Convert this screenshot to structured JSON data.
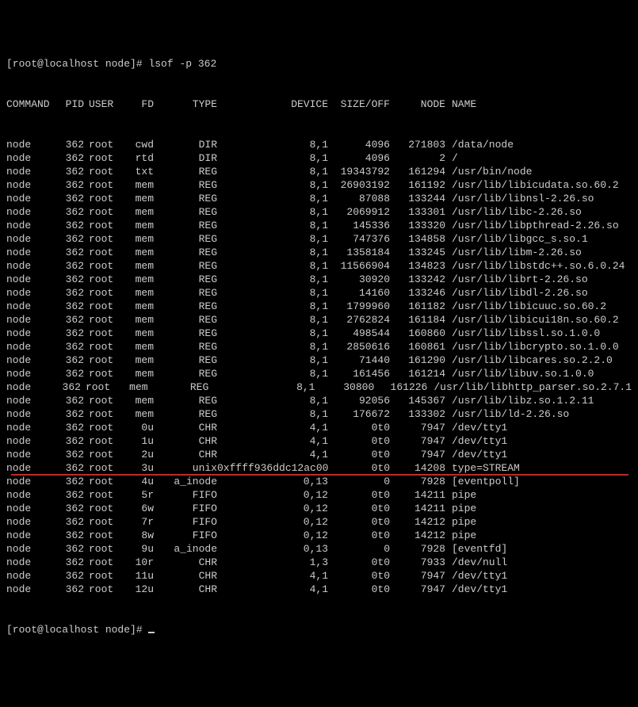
{
  "prompt1": {
    "prefix": "[root@localhost node]# ",
    "cmd": "lsof -p 362"
  },
  "prompt2": {
    "prefix": "[root@localhost node]# "
  },
  "header": {
    "cmd": "COMMAND",
    "pid": "PID",
    "user": "USER",
    "fd": "FD",
    "type": "TYPE",
    "dev": "DEVICE",
    "size": "SIZE/OFF",
    "node": "NODE",
    "name": "NAME"
  },
  "rows": [
    {
      "cmd": "node",
      "pid": "362",
      "user": "root",
      "fd": "cwd",
      "type": "DIR",
      "dev": "8,1",
      "size": "4096",
      "node": "271803",
      "name": "/data/node"
    },
    {
      "cmd": "node",
      "pid": "362",
      "user": "root",
      "fd": "rtd",
      "type": "DIR",
      "dev": "8,1",
      "size": "4096",
      "node": "2",
      "name": "/"
    },
    {
      "cmd": "node",
      "pid": "362",
      "user": "root",
      "fd": "txt",
      "type": "REG",
      "dev": "8,1",
      "size": "19343792",
      "node": "161294",
      "name": "/usr/bin/node"
    },
    {
      "cmd": "node",
      "pid": "362",
      "user": "root",
      "fd": "mem",
      "type": "REG",
      "dev": "8,1",
      "size": "26903192",
      "node": "161192",
      "name": "/usr/lib/libicudata.so.60.2"
    },
    {
      "cmd": "node",
      "pid": "362",
      "user": "root",
      "fd": "mem",
      "type": "REG",
      "dev": "8,1",
      "size": "87088",
      "node": "133244",
      "name": "/usr/lib/libnsl-2.26.so"
    },
    {
      "cmd": "node",
      "pid": "362",
      "user": "root",
      "fd": "mem",
      "type": "REG",
      "dev": "8,1",
      "size": "2069912",
      "node": "133301",
      "name": "/usr/lib/libc-2.26.so"
    },
    {
      "cmd": "node",
      "pid": "362",
      "user": "root",
      "fd": "mem",
      "type": "REG",
      "dev": "8,1",
      "size": "145336",
      "node": "133320",
      "name": "/usr/lib/libpthread-2.26.so"
    },
    {
      "cmd": "node",
      "pid": "362",
      "user": "root",
      "fd": "mem",
      "type": "REG",
      "dev": "8,1",
      "size": "747376",
      "node": "134858",
      "name": "/usr/lib/libgcc_s.so.1"
    },
    {
      "cmd": "node",
      "pid": "362",
      "user": "root",
      "fd": "mem",
      "type": "REG",
      "dev": "8,1",
      "size": "1358184",
      "node": "133245",
      "name": "/usr/lib/libm-2.26.so"
    },
    {
      "cmd": "node",
      "pid": "362",
      "user": "root",
      "fd": "mem",
      "type": "REG",
      "dev": "8,1",
      "size": "11566904",
      "node": "134823",
      "name": "/usr/lib/libstdc++.so.6.0.24"
    },
    {
      "cmd": "node",
      "pid": "362",
      "user": "root",
      "fd": "mem",
      "type": "REG",
      "dev": "8,1",
      "size": "30920",
      "node": "133242",
      "name": "/usr/lib/librt-2.26.so"
    },
    {
      "cmd": "node",
      "pid": "362",
      "user": "root",
      "fd": "mem",
      "type": "REG",
      "dev": "8,1",
      "size": "14160",
      "node": "133246",
      "name": "/usr/lib/libdl-2.26.so"
    },
    {
      "cmd": "node",
      "pid": "362",
      "user": "root",
      "fd": "mem",
      "type": "REG",
      "dev": "8,1",
      "size": "1799960",
      "node": "161182",
      "name": "/usr/lib/libicuuc.so.60.2"
    },
    {
      "cmd": "node",
      "pid": "362",
      "user": "root",
      "fd": "mem",
      "type": "REG",
      "dev": "8,1",
      "size": "2762824",
      "node": "161184",
      "name": "/usr/lib/libicui18n.so.60.2"
    },
    {
      "cmd": "node",
      "pid": "362",
      "user": "root",
      "fd": "mem",
      "type": "REG",
      "dev": "8,1",
      "size": "498544",
      "node": "160860",
      "name": "/usr/lib/libssl.so.1.0.0"
    },
    {
      "cmd": "node",
      "pid": "362",
      "user": "root",
      "fd": "mem",
      "type": "REG",
      "dev": "8,1",
      "size": "2850616",
      "node": "160861",
      "name": "/usr/lib/libcrypto.so.1.0.0"
    },
    {
      "cmd": "node",
      "pid": "362",
      "user": "root",
      "fd": "mem",
      "type": "REG",
      "dev": "8,1",
      "size": "71440",
      "node": "161290",
      "name": "/usr/lib/libcares.so.2.2.0"
    },
    {
      "cmd": "node",
      "pid": "362",
      "user": "root",
      "fd": "mem",
      "type": "REG",
      "dev": "8,1",
      "size": "161456",
      "node": "161214",
      "name": "/usr/lib/libuv.so.1.0.0"
    },
    {
      "cmd": "node",
      "pid": "362",
      "user": "root",
      "fd": "mem",
      "type": "REG",
      "dev": "8,1",
      "size": "30800",
      "node": "161226",
      "name": "/usr/lib/libhttp_parser.so.2.7.1"
    },
    {
      "cmd": "node",
      "pid": "362",
      "user": "root",
      "fd": "mem",
      "type": "REG",
      "dev": "8,1",
      "size": "92056",
      "node": "145367",
      "name": "/usr/lib/libz.so.1.2.11"
    },
    {
      "cmd": "node",
      "pid": "362",
      "user": "root",
      "fd": "mem",
      "type": "REG",
      "dev": "8,1",
      "size": "176672",
      "node": "133302",
      "name": "/usr/lib/ld-2.26.so"
    },
    {
      "cmd": "node",
      "pid": "362",
      "user": "root",
      "fd": "0u",
      "type": "CHR",
      "dev": "4,1",
      "size": "0t0",
      "node": "7947",
      "name": "/dev/tty1"
    },
    {
      "cmd": "node",
      "pid": "362",
      "user": "root",
      "fd": "1u",
      "type": "CHR",
      "dev": "4,1",
      "size": "0t0",
      "node": "7947",
      "name": "/dev/tty1"
    },
    {
      "cmd": "node",
      "pid": "362",
      "user": "root",
      "fd": "2u",
      "type": "CHR",
      "dev": "4,1",
      "size": "0t0",
      "node": "7947",
      "name": "/dev/tty1"
    },
    {
      "cmd": "node",
      "pid": "362",
      "user": "root",
      "fd": "3u",
      "type": "unix",
      "dev": "0xffff936ddc12ac00",
      "size": "0t0",
      "node": "14208",
      "name": "type=STREAM",
      "hl": true
    },
    {
      "cmd": "node",
      "pid": "362",
      "user": "root",
      "fd": "4u",
      "type": "a_inode",
      "dev": "0,13",
      "size": "0",
      "node": "7928",
      "name": "[eventpoll]"
    },
    {
      "cmd": "node",
      "pid": "362",
      "user": "root",
      "fd": "5r",
      "type": "FIFO",
      "dev": "0,12",
      "size": "0t0",
      "node": "14211",
      "name": "pipe"
    },
    {
      "cmd": "node",
      "pid": "362",
      "user": "root",
      "fd": "6w",
      "type": "FIFO",
      "dev": "0,12",
      "size": "0t0",
      "node": "14211",
      "name": "pipe"
    },
    {
      "cmd": "node",
      "pid": "362",
      "user": "root",
      "fd": "7r",
      "type": "FIFO",
      "dev": "0,12",
      "size": "0t0",
      "node": "14212",
      "name": "pipe"
    },
    {
      "cmd": "node",
      "pid": "362",
      "user": "root",
      "fd": "8w",
      "type": "FIFO",
      "dev": "0,12",
      "size": "0t0",
      "node": "14212",
      "name": "pipe"
    },
    {
      "cmd": "node",
      "pid": "362",
      "user": "root",
      "fd": "9u",
      "type": "a_inode",
      "dev": "0,13",
      "size": "0",
      "node": "7928",
      "name": "[eventfd]"
    },
    {
      "cmd": "node",
      "pid": "362",
      "user": "root",
      "fd": "10r",
      "type": "CHR",
      "dev": "1,3",
      "size": "0t0",
      "node": "7933",
      "name": "/dev/null"
    },
    {
      "cmd": "node",
      "pid": "362",
      "user": "root",
      "fd": "11u",
      "type": "CHR",
      "dev": "4,1",
      "size": "0t0",
      "node": "7947",
      "name": "/dev/tty1"
    },
    {
      "cmd": "node",
      "pid": "362",
      "user": "root",
      "fd": "12u",
      "type": "CHR",
      "dev": "4,1",
      "size": "0t0",
      "node": "7947",
      "name": "/dev/tty1"
    }
  ]
}
